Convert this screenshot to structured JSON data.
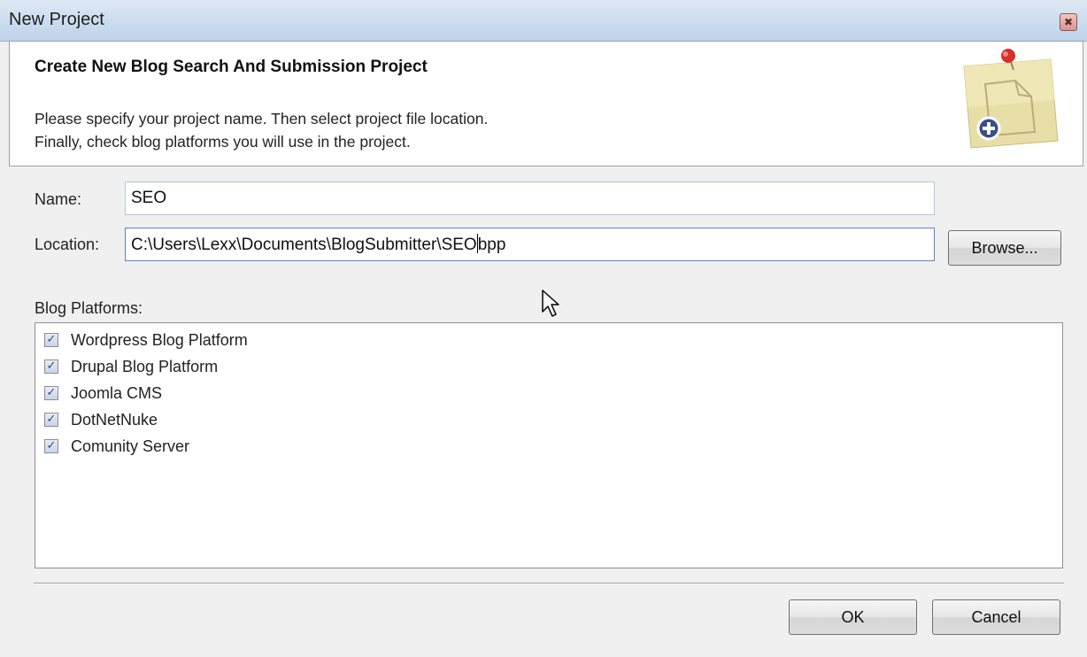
{
  "window": {
    "title": "New Project",
    "close_glyph": "✖"
  },
  "header": {
    "title": "Create New Blog Search And Submission Project",
    "description_line1": "Please specify your project name. Then select project file location.",
    "description_line2": "Finally, check blog platforms you will use in the project.",
    "icon": "sticky-note-add-icon"
  },
  "form": {
    "name_label": "Name:",
    "name_value": "SEO",
    "location_label": "Location:",
    "location_value_before_caret": "C:\\Users\\Lexx\\Documents\\BlogSubmitter\\SEO",
    "location_value_after_caret": "bpp",
    "browse_label": "Browse..."
  },
  "platforms": {
    "label": "Blog Platforms:",
    "items": [
      {
        "label": "Wordpress Blog Platform",
        "checked": true
      },
      {
        "label": "Drupal Blog Platform",
        "checked": true
      },
      {
        "label": "Joomla CMS",
        "checked": true
      },
      {
        "label": "DotNetNuke",
        "checked": true
      },
      {
        "label": "Comunity Server",
        "checked": true
      }
    ],
    "check_glyph": "✓"
  },
  "footer": {
    "ok_label": "OK",
    "cancel_label": "Cancel"
  },
  "colors": {
    "titlebar": "#cbdcef",
    "dialog_bg": "#f0f0f0",
    "header_bg": "#ffffff",
    "checkbox_tick": "#2b4a8c"
  }
}
